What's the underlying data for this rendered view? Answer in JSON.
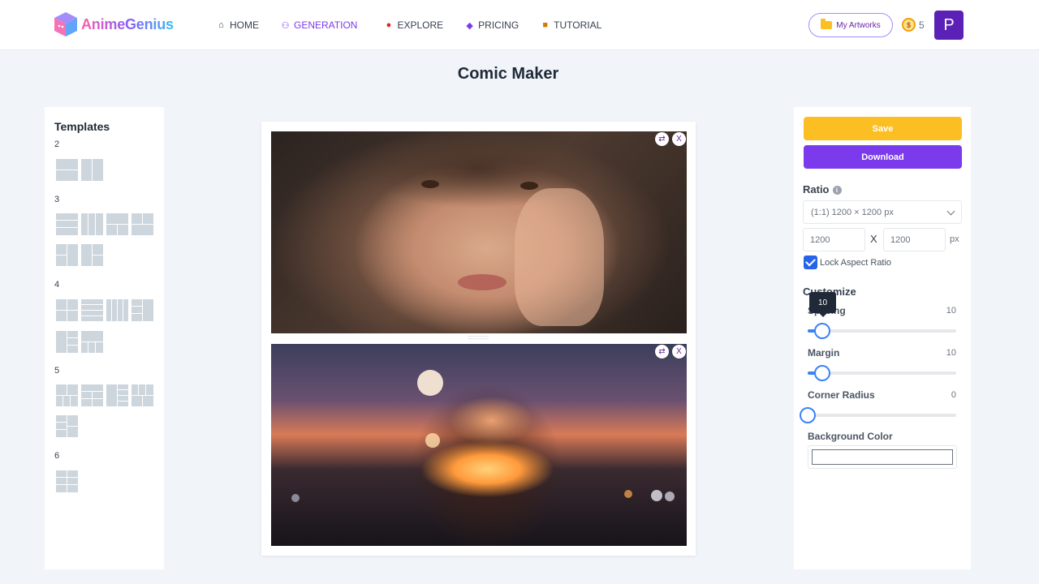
{
  "header": {
    "logo_text": "AnimeGenius",
    "nav": [
      {
        "label": "HOME",
        "icon": "home-icon"
      },
      {
        "label": "GENERATION",
        "icon": "robot-icon"
      },
      {
        "label": "EXPLORE",
        "icon": "pin-icon"
      },
      {
        "label": "PRICING",
        "icon": "diamond-icon"
      },
      {
        "label": "TUTORIAL",
        "icon": "book-icon"
      }
    ],
    "active_nav": "GENERATION",
    "my_artworks_label": "My Artworks",
    "coin_count": "5",
    "avatar_letter": "P"
  },
  "page_title": "Comic Maker",
  "templates": {
    "title": "Templates",
    "groups": [
      {
        "count": "2"
      },
      {
        "count": "3"
      },
      {
        "count": "4"
      },
      {
        "count": "5"
      },
      {
        "count": "6"
      }
    ]
  },
  "toolbar": {
    "save_label": "Save",
    "download_label": "Download"
  },
  "ratio": {
    "label": "Ratio",
    "selected": "(1:1) 1200 × 1200 px",
    "width": "1200",
    "height": "1200",
    "times": "X",
    "unit": "px",
    "lock_label": "Lock Aspect Ratio",
    "lock_checked": true
  },
  "customize": {
    "label": "Customize",
    "spacing": {
      "label": "Spacing",
      "value": "10",
      "fraction": 0.1
    },
    "margin": {
      "label": "Margin",
      "value": "10",
      "fraction": 0.1
    },
    "corner_radius": {
      "label": "Corner Radius",
      "value": "0",
      "fraction": 0.0
    },
    "tooltip": "10",
    "background_label": "Background Color",
    "background_color": "#ffffff"
  },
  "colors": {
    "accent": "#7c3aed",
    "save": "#fbbf24",
    "slider": "#3b82f6"
  }
}
